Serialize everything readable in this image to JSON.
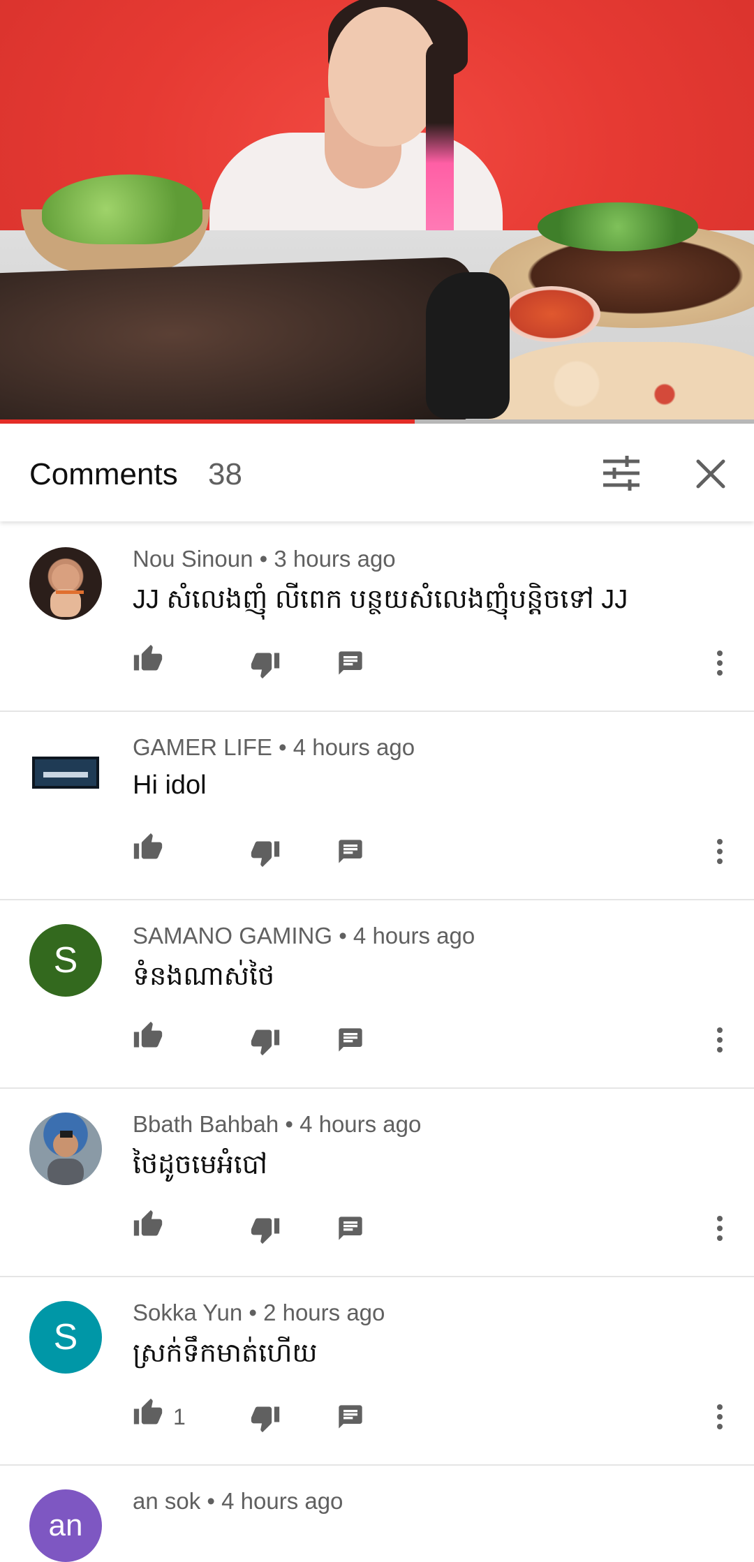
{
  "video": {
    "progress_fraction": 0.55,
    "progress_color": "#e52d27"
  },
  "comments_panel": {
    "title": "Comments",
    "count": "38",
    "filter_icon": "sort-filter-icon",
    "close_icon": "close-icon"
  },
  "comments": [
    {
      "author": "Nou Sinoun",
      "time": "3 hours ago",
      "meta": "Nou Sinoun • 3 hours ago",
      "text": "JJ សំលេងញុំ លីពេក បន្ថយសំលេងញុំបន្តិចទៅ JJ",
      "likes": "",
      "avatar": {
        "type": "photo",
        "color": "#6a4a3c"
      }
    },
    {
      "author": "GAMER LIFE",
      "time": "4 hours ago",
      "meta": "GAMER LIFE • 4 hours ago",
      "text": "Hi idol",
      "likes": "",
      "avatar": {
        "type": "logo",
        "color": "#1e2a3a"
      }
    },
    {
      "author": "SAMANO GAMING",
      "time": "4 hours ago",
      "meta": "SAMANO GAMING • 4 hours ago",
      "text": "ទំនងណាស់ថៃ",
      "likes": "",
      "avatar": {
        "type": "letter",
        "letter": "S",
        "color": "#33691e"
      }
    },
    {
      "author": "Bbath Bahbah",
      "time": "4 hours ago",
      "meta": "Bbath Bahbah • 4 hours ago",
      "text": "ថៃដូចមេអំបៅ",
      "likes": "",
      "avatar": {
        "type": "photo",
        "color": "#7d8a96"
      }
    },
    {
      "author": "Sokka Yun",
      "time": "2 hours ago",
      "meta": "Sokka Yun • 2 hours ago",
      "text": "ស្រក់ទឹកមាត់ហើយ",
      "likes": "1",
      "avatar": {
        "type": "letter",
        "letter": "S",
        "color": "#0097a7"
      }
    },
    {
      "author": "an sok",
      "time": "4 hours ago",
      "meta": "an sok • 4 hours ago",
      "text": "",
      "likes": "",
      "avatar": {
        "type": "letter",
        "letter": "an",
        "color": "#7e57c2"
      }
    }
  ],
  "icons": {
    "like": "thumbs-up-icon",
    "dislike": "thumbs-down-icon",
    "reply": "reply-comment-icon",
    "more": "more-vert-icon"
  }
}
